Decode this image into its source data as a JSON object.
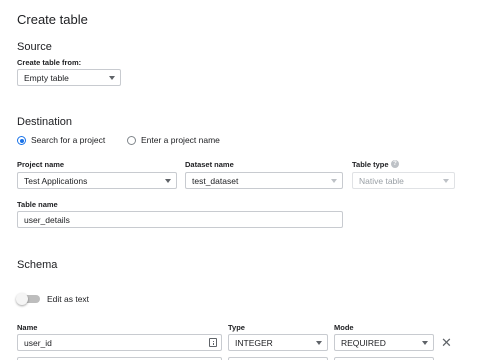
{
  "page_title": "Create table",
  "source": {
    "heading": "Source",
    "create_from_label": "Create table from:",
    "create_from_value": "Empty table"
  },
  "destination": {
    "heading": "Destination",
    "radio_search_label": "Search for a project",
    "radio_enter_label": "Enter a project name",
    "selected_radio": "Search for a project",
    "project_name_label": "Project name",
    "project_name_value": "Test Applications",
    "dataset_name_label": "Dataset name",
    "dataset_name_value": "test_dataset",
    "table_type_label": "Table type",
    "table_type_help": "?",
    "table_type_value": "Native table",
    "table_name_label": "Table name",
    "table_name_value": "user_details"
  },
  "schema": {
    "heading": "Schema",
    "edit_as_text_label": "Edit as text",
    "edit_as_text_enabled": false,
    "columns": {
      "name": "Name",
      "type": "Type",
      "mode": "Mode"
    },
    "fields": [
      {
        "name": "user_id",
        "type": "INTEGER",
        "mode": "REQUIRED"
      }
    ],
    "remove_symbol": "✕"
  },
  "colors": {
    "accent": "#1a73e8",
    "border": "#c8cbd0",
    "text": "#202124",
    "muted": "#9aa0a6"
  }
}
